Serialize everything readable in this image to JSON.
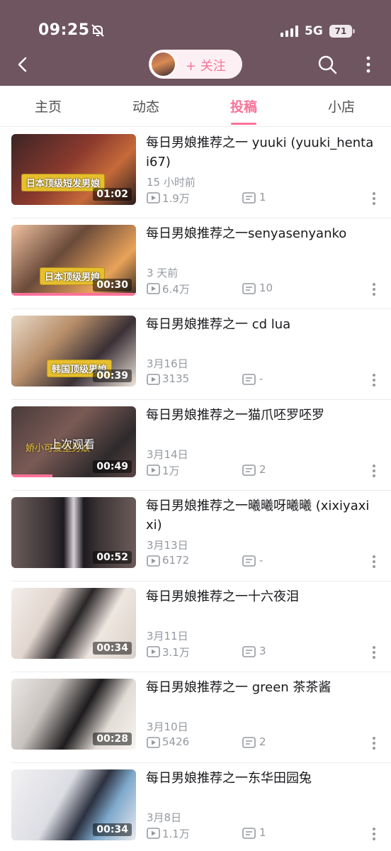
{
  "status_bar": {
    "time": "09:25",
    "network": "5G",
    "battery": "71"
  },
  "header": {
    "follow_label": "+ 关注"
  },
  "tabs": [
    {
      "label": "主页"
    },
    {
      "label": "动态"
    },
    {
      "label": "投稿"
    },
    {
      "label": "小店"
    }
  ],
  "active_tab": "投稿",
  "videos": [
    {
      "title": "每日男娘推荐之一 yuuki (yuuki_hentai67)",
      "date": "15 小时前",
      "plays": "1.9万",
      "comments": "1",
      "duration": "01:02",
      "badge": "日本顶级短发男娘"
    },
    {
      "title": "每日男娘推荐之一senyasenyanko",
      "date": "3 天前",
      "plays": "6.4万",
      "comments": "10",
      "duration": "00:30",
      "badge": "日本顶级男娘",
      "progress": 1.0
    },
    {
      "title": "每日男娘推荐之一 cd lua",
      "date": "3月16日",
      "plays": "3135",
      "comments": "-",
      "duration": "00:39",
      "badge": "韩国顶级男娘"
    },
    {
      "title": "每日男娘推荐之一猫爪呸罗呸罗",
      "date": "3月14日",
      "plays": "1万",
      "comments": "2",
      "duration": "00:49",
      "overlay": "上次观看",
      "badge": "娇小可爱型男娘",
      "progress": 0.33
    },
    {
      "title": "每日男娘推荐之一曦曦呀曦曦 (xixiyaxixi)",
      "date": "3月13日",
      "plays": "6172",
      "comments": "-",
      "duration": "00:52"
    },
    {
      "title": "每日男娘推荐之一十六夜泪",
      "date": "3月11日",
      "plays": "3.1万",
      "comments": "3",
      "duration": "00:34"
    },
    {
      "title": "每日男娘推荐之一 green 茶茶酱",
      "date": "3月10日",
      "plays": "5426",
      "comments": "2",
      "duration": "00:28"
    },
    {
      "title": "每日男娘推荐之一东华田园兔",
      "date": "3月8日",
      "plays": "1.1万",
      "comments": "1",
      "duration": "00:34"
    }
  ],
  "colors": {
    "header_bg": "#6e5560",
    "accent": "#fb7299",
    "meta_text": "#9499a0"
  },
  "icons": [
    "bell-off-icon",
    "signal-icon",
    "battery-icon",
    "back-arrow-icon",
    "search-icon",
    "more-vertical-icon",
    "play-count-icon",
    "comment-icon"
  ]
}
